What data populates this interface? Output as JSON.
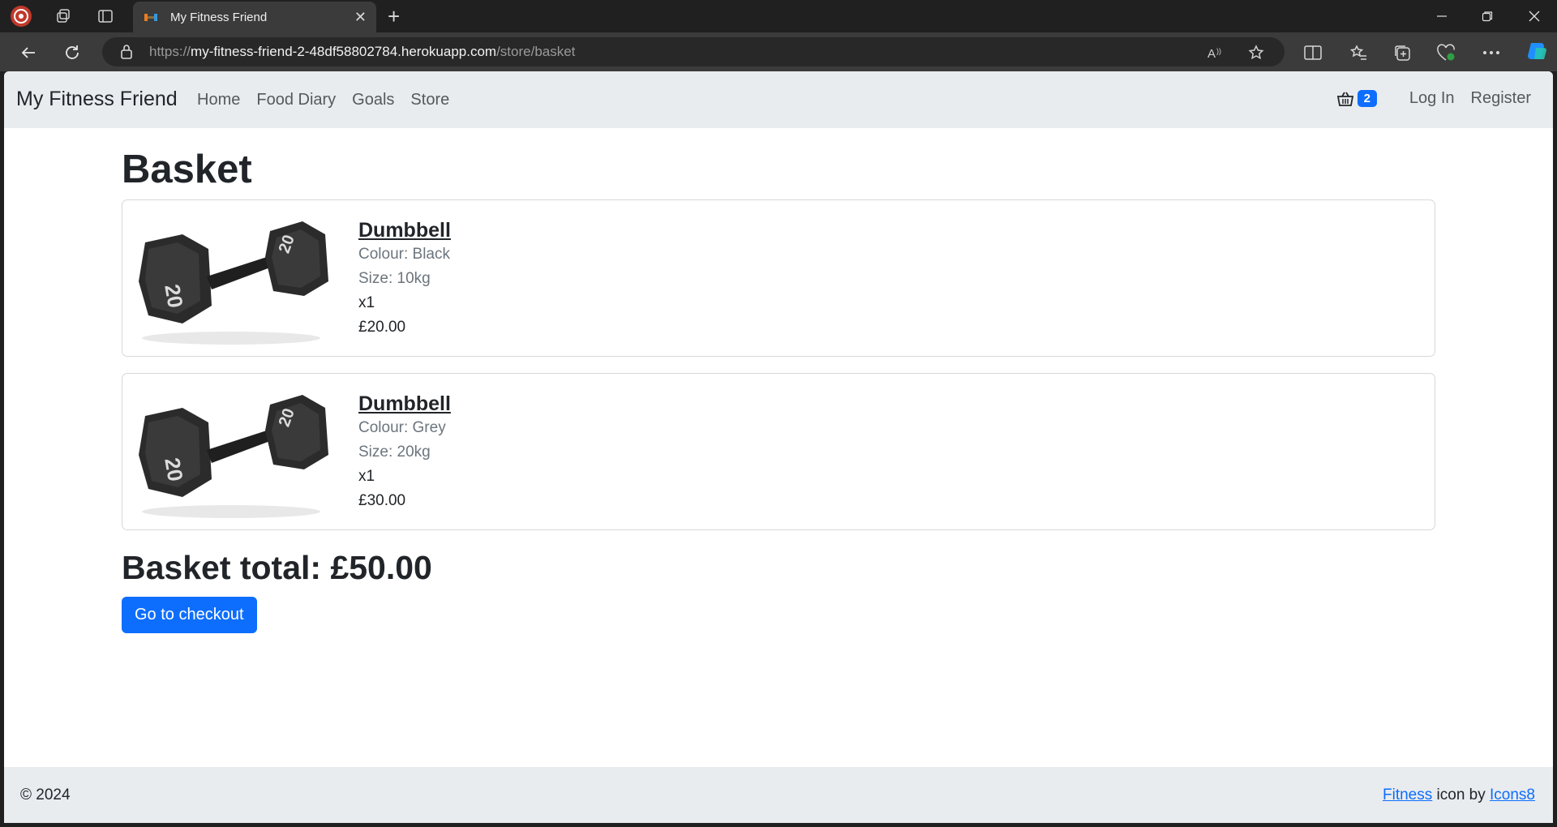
{
  "browser": {
    "tab_title": "My Fitness Friend",
    "url_prefix": "https://",
    "url_host": "my-fitness-friend-2-48df58802784.herokuapp.com",
    "url_path": "/store/basket"
  },
  "site": {
    "brand": "My Fitness Friend",
    "nav": [
      "Home",
      "Food Diary",
      "Goals",
      "Store"
    ],
    "basket_count": "2",
    "login": "Log In",
    "register": "Register"
  },
  "page": {
    "title": "Basket",
    "items": [
      {
        "name": "Dumbbell",
        "colour": "Colour: Black",
        "size": "Size: 10kg",
        "qty": "x1",
        "price": "£20.00"
      },
      {
        "name": "Dumbbell",
        "colour": "Colour: Grey",
        "size": "Size: 20kg",
        "qty": "x1",
        "price": "£30.00"
      }
    ],
    "total": "Basket total: £50.00",
    "checkout": "Go to checkout"
  },
  "footer": {
    "copyright": "© 2024",
    "credit_link1": "Fitness",
    "credit_middle": " icon by ",
    "credit_link2": "Icons8"
  },
  "colors": {
    "primary": "#0d6efd",
    "nav_bg": "#e9ecef"
  }
}
